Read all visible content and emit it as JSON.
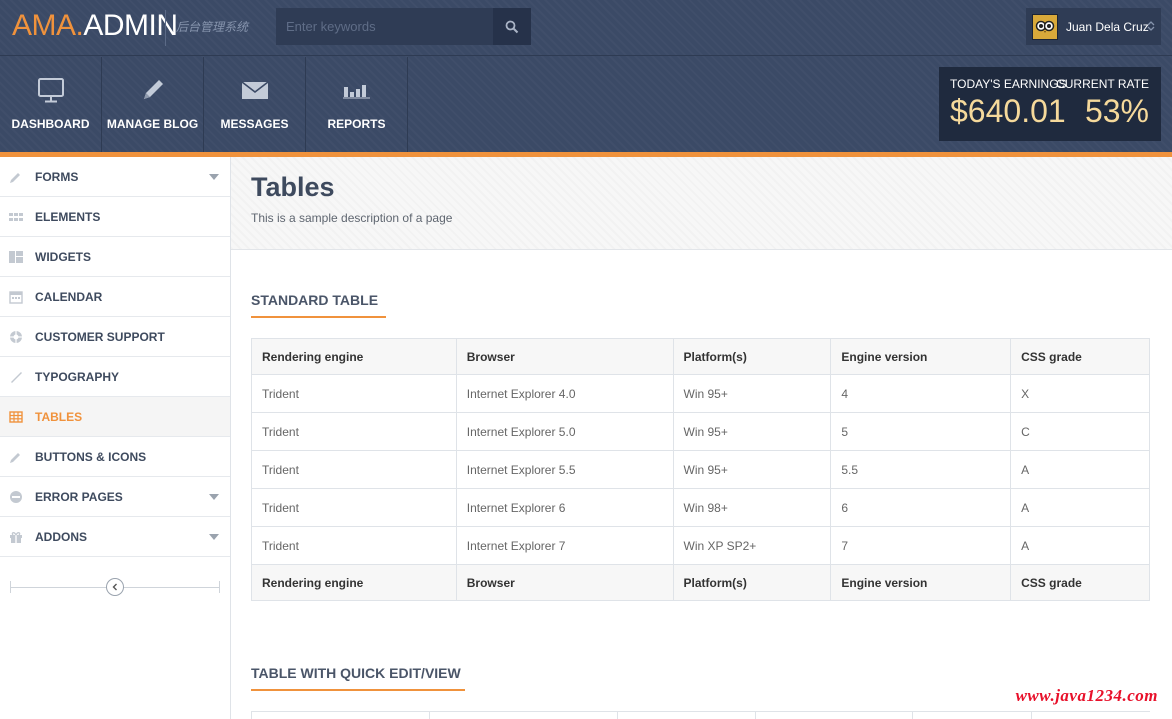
{
  "header": {
    "logo_part1": "AMA.",
    "logo_part2": "ADMIN",
    "tagline": "后台管理系统",
    "search_placeholder": "Enter keywords",
    "user_name": "Juan Dela Cruz"
  },
  "nav": [
    {
      "label": "DASHBOARD",
      "icon": "monitor-icon"
    },
    {
      "label": "MANAGE BLOG",
      "icon": "pencil-icon"
    },
    {
      "label": "MESSAGES",
      "icon": "envelope-icon"
    },
    {
      "label": "REPORTS",
      "icon": "bar-chart-icon"
    }
  ],
  "stats": {
    "earnings_label": "TODAY'S EARNINGS",
    "earnings_value": "$640.01",
    "rate_label": "CURRENT RATE",
    "rate_value": "53%"
  },
  "sidebar": {
    "items": [
      {
        "label": "FORMS",
        "icon": "pencil-icon",
        "has_caret": true
      },
      {
        "label": "ELEMENTS",
        "icon": "grid-icon",
        "has_caret": false
      },
      {
        "label": "WIDGETS",
        "icon": "widgets-icon",
        "has_caret": false
      },
      {
        "label": "CALENDAR",
        "icon": "calendar-icon",
        "has_caret": false
      },
      {
        "label": "CUSTOMER SUPPORT",
        "icon": "lifebuoy-icon",
        "has_caret": false
      },
      {
        "label": "TYPOGRAPHY",
        "icon": "brush-icon",
        "has_caret": false
      },
      {
        "label": "TABLES",
        "icon": "table-icon",
        "has_caret": false,
        "active": true
      },
      {
        "label": "BUTTONS & ICONS",
        "icon": "pencil-icon",
        "has_caret": false
      },
      {
        "label": "ERROR PAGES",
        "icon": "no-entry-icon",
        "has_caret": true
      },
      {
        "label": "ADDONS",
        "icon": "gift-icon",
        "has_caret": true
      }
    ]
  },
  "page": {
    "title": "Tables",
    "description": "This is a sample description of a page"
  },
  "standard_table": {
    "title": "STANDARD TABLE",
    "columns": [
      "Rendering engine",
      "Browser",
      "Platform(s)",
      "Engine version",
      "CSS grade"
    ],
    "rows": [
      [
        "Trident",
        "Internet Explorer 4.0",
        "Win 95+",
        "4",
        "X"
      ],
      [
        "Trident",
        "Internet Explorer 5.0",
        "Win 95+",
        "5",
        "C"
      ],
      [
        "Trident",
        "Internet Explorer 5.5",
        "Win 95+",
        "5.5",
        "A"
      ],
      [
        "Trident",
        "Internet Explorer 6",
        "Win 98+",
        "6",
        "A"
      ],
      [
        "Trident",
        "Internet Explorer 7",
        "Win XP SP2+",
        "7",
        "A"
      ]
    ]
  },
  "quick_edit_table": {
    "title": "TABLE WITH QUICK EDIT/VIEW"
  },
  "watermark": "www.java1234.com",
  "colors": {
    "header_bg": "#3b4a66",
    "accent": "#f0923c",
    "stats_bg": "#1f2a3e",
    "stat_value": "#f5d99b"
  }
}
